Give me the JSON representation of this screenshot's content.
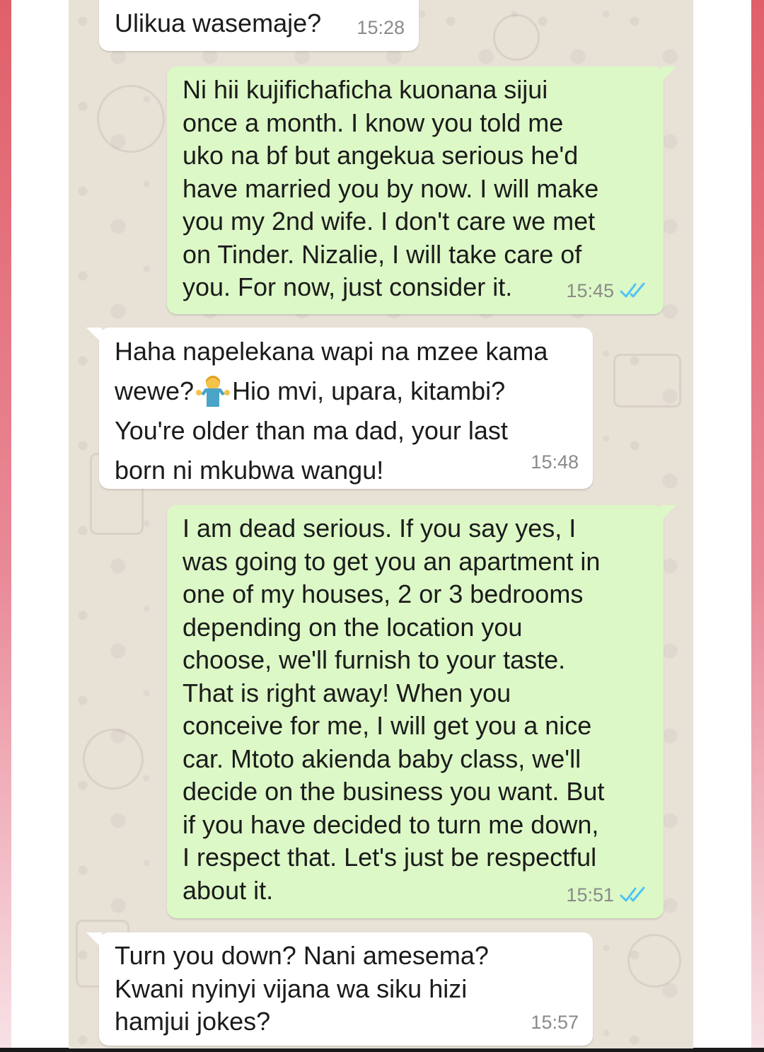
{
  "colors": {
    "frame_accent": "#e0606a",
    "chat_background": "#e8e1d6",
    "outgoing_bubble": "#dcf8c6",
    "incoming_bubble": "#ffffff",
    "read_ticks": "#4fc3f7",
    "timestamp": "#8a8a8a"
  },
  "messages": [
    {
      "direction": "incoming",
      "text": "Ulikua wasemaje?",
      "time": "15:28"
    },
    {
      "direction": "outgoing",
      "text": "Ni hii kujifichaficha kuonana sijui\nonce a month. I know you told me\nuko na bf but angekua serious he'd\nhave married you by now. I will make\nyou my 2nd wife. I don't care we met\non Tinder. Nizalie, I will take care of\nyou. For now, just consider it.",
      "time": "15:45",
      "status_icon": "double-check-read-icon"
    },
    {
      "direction": "incoming",
      "text_before_emoji": "Haha napelekana wapi na mzee kama\nwewe?",
      "emoji": "person-shrugging-emoji",
      "text_after_emoji": "Hio mvi, upara, kitambi?\nYou're older than ma dad, your last\nborn ni mkubwa wangu!",
      "time": "15:48"
    },
    {
      "direction": "outgoing",
      "text": "I am dead serious. If you say yes, I\nwas going to get you an apartment in\none of my houses, 2 or 3 bedrooms\ndepending on the location you\nchoose, we'll furnish to your taste.\nThat is right away! When you\nconceive for me, I will get you a nice\ncar. Mtoto akienda baby class, we'll\ndecide on the business you want. But\nif you have decided to turn me down,\nI respect that. Let's just be respectful\nabout it.",
      "time": "15:51",
      "status_icon": "double-check-read-icon"
    },
    {
      "direction": "incoming",
      "text": "Turn you down? Nani amesema?\nKwani nyinyi vijana wa siku hizi\nhamjui jokes?",
      "time": "15:57"
    }
  ]
}
